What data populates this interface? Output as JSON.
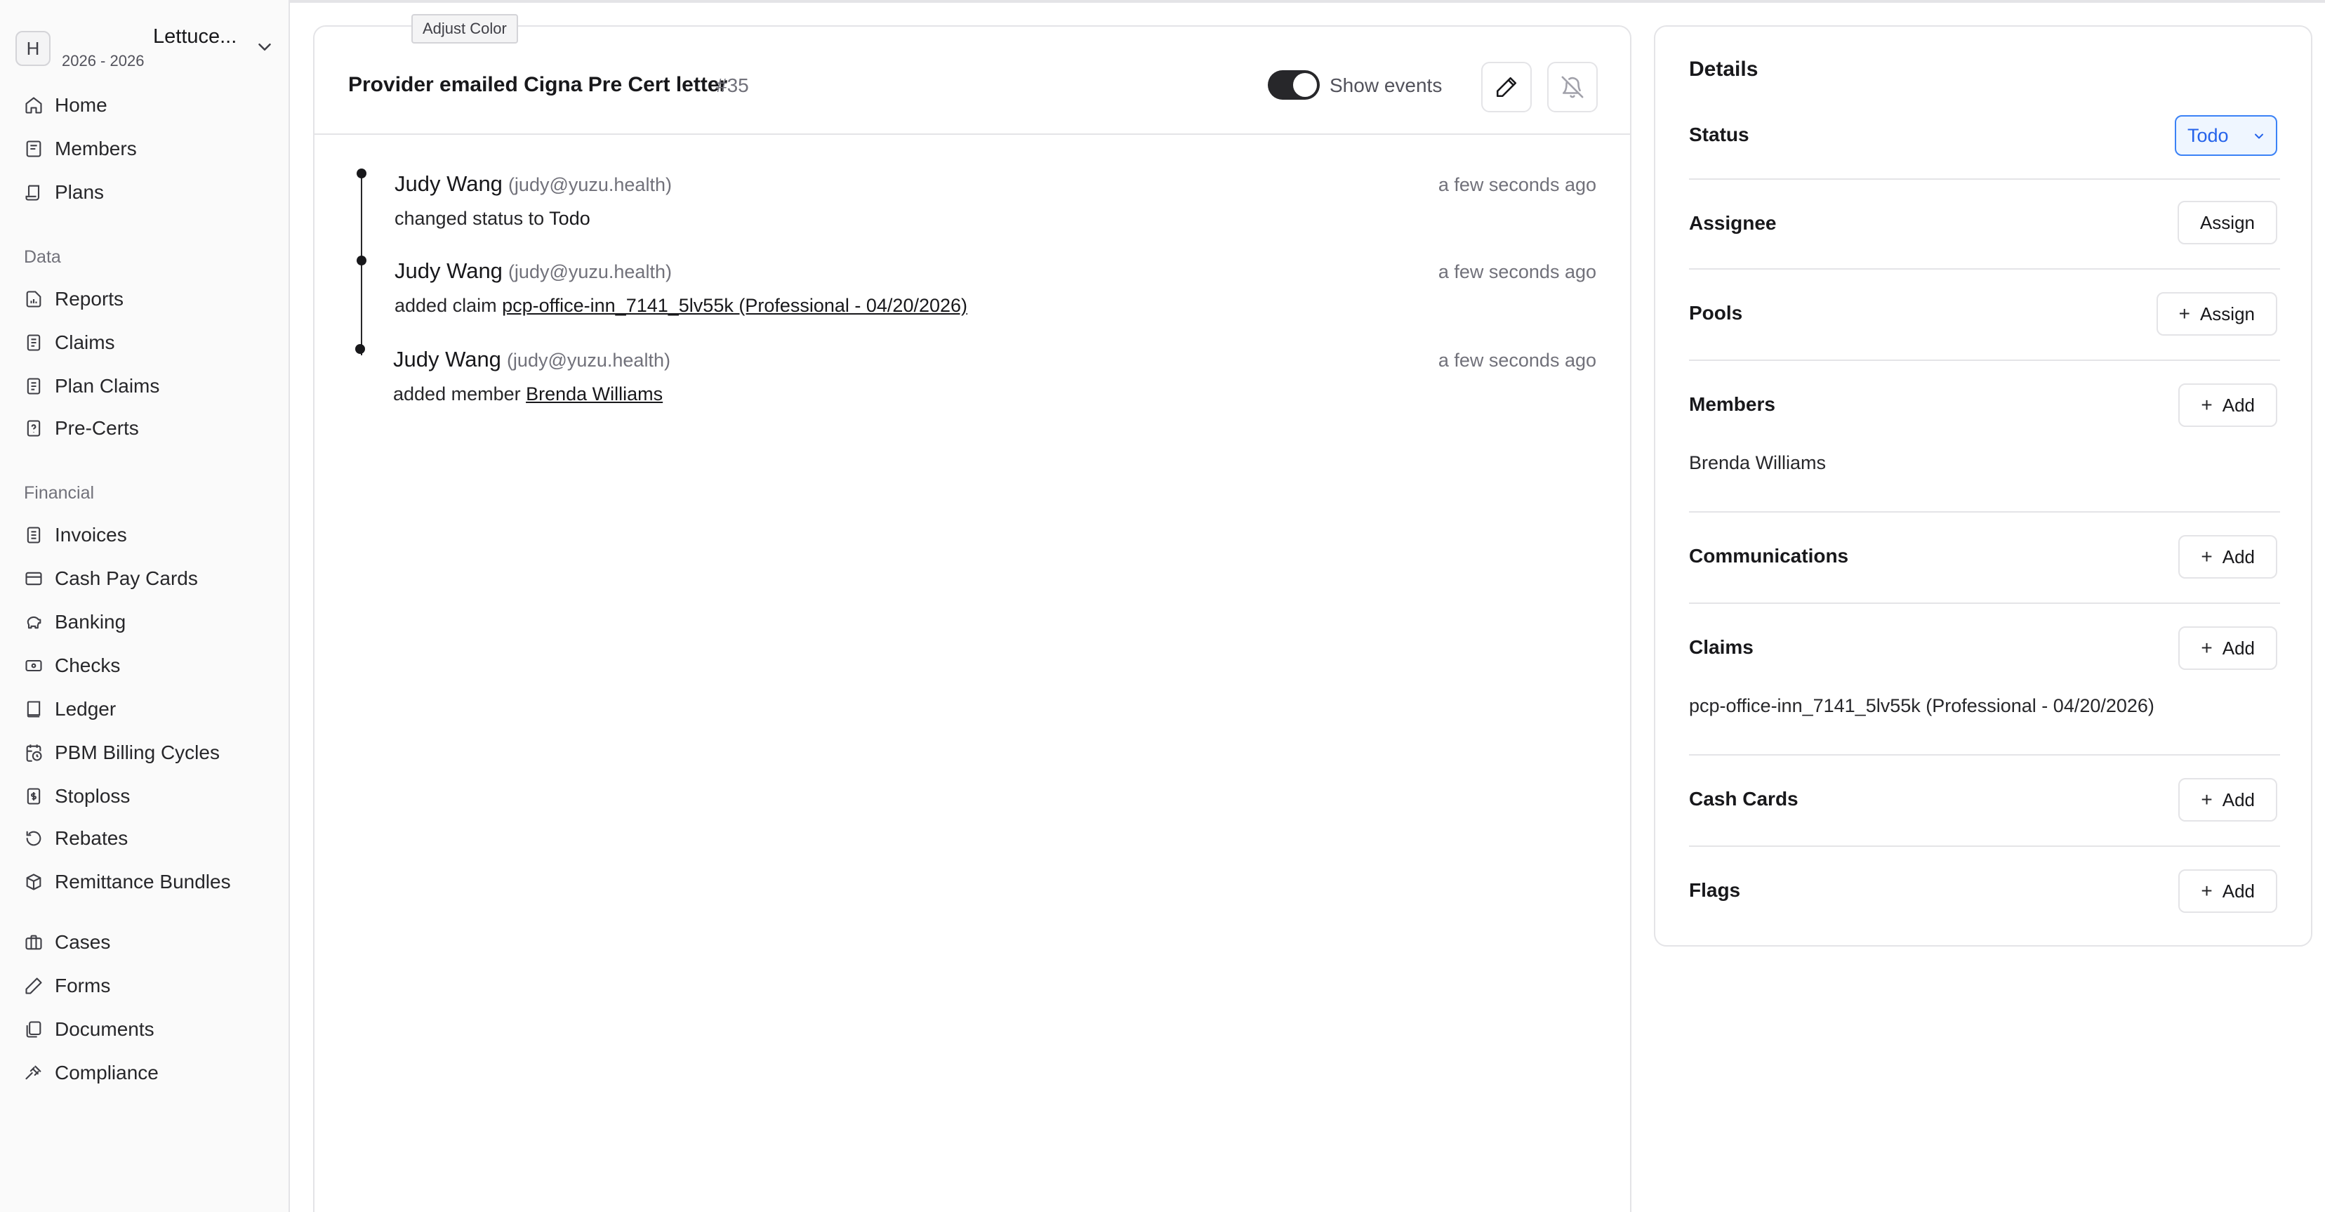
{
  "tooltip": "Adjust Color",
  "org": {
    "avatar_letter": "H",
    "name": "Lettuce...",
    "years": "2026 - 2026",
    "chevron_icon": "chevron-down-icon"
  },
  "sidebar": {
    "top_items": [
      {
        "label": "Home",
        "icon": "home-icon"
      },
      {
        "label": "Members",
        "icon": "book-icon"
      },
      {
        "label": "Plans",
        "icon": "scroll-icon"
      }
    ],
    "data_label": "Data",
    "data_items": [
      {
        "label": "Reports",
        "icon": "file-chart-icon"
      },
      {
        "label": "Claims",
        "icon": "file-text-icon"
      },
      {
        "label": "Plan Claims",
        "icon": "file-text-icon"
      },
      {
        "label": "Pre-Certs",
        "icon": "file-question-icon"
      }
    ],
    "financial_label": "Financial",
    "financial_items": [
      {
        "label": "Invoices",
        "icon": "receipt-icon"
      },
      {
        "label": "Cash Pay Cards",
        "icon": "credit-card-icon"
      },
      {
        "label": "Banking",
        "icon": "piggy-bank-icon"
      },
      {
        "label": "Checks",
        "icon": "banknote-icon"
      },
      {
        "label": "Ledger",
        "icon": "notebook-icon"
      },
      {
        "label": "PBM Billing Cycles",
        "icon": "calendar-clock-icon"
      },
      {
        "label": "Stoploss",
        "icon": "file-dollar-icon"
      },
      {
        "label": "Rebates",
        "icon": "rotate-icon"
      },
      {
        "label": "Remittance Bundles",
        "icon": "package-icon"
      }
    ],
    "other_items": [
      {
        "label": "Cases",
        "icon": "briefcase-icon"
      },
      {
        "label": "Forms",
        "icon": "pen-icon"
      },
      {
        "label": "Documents",
        "icon": "files-icon"
      },
      {
        "label": "Compliance",
        "icon": "gavel-icon"
      }
    ]
  },
  "case": {
    "title": "Provider emailed Cigna Pre Cert letter",
    "number": "#35",
    "show_events_label": "Show events",
    "show_events_on": true
  },
  "events": [
    {
      "author": "Judy Wang",
      "email": "(judy@yuzu.health)",
      "time": "a few seconds ago",
      "prefix": "changed status to ",
      "target": "Todo",
      "target_is_link": false
    },
    {
      "author": "Judy Wang",
      "email": "(judy@yuzu.health)",
      "time": "a few seconds ago",
      "prefix": "added claim ",
      "target": "pcp-office-inn_7141_5lv55k (Professional - 04/20/2026)",
      "target_is_link": true
    },
    {
      "author": "Judy Wang",
      "email": "(judy@yuzu.health)",
      "time": "a few seconds ago",
      "prefix": "added member ",
      "target": "Brenda Williams",
      "target_is_link": true
    }
  ],
  "details": {
    "title": "Details",
    "status_label": "Status",
    "status_value": "Todo",
    "assignee_label": "Assignee",
    "assignee_button": "Assign",
    "pools_label": "Pools",
    "pools_button": "Assign",
    "members_label": "Members",
    "members_button": "Add",
    "members_value": "Brenda Williams",
    "communications_label": "Communications",
    "communications_button": "Add",
    "claims_label": "Claims",
    "claims_button": "Add",
    "claims_value": "pcp-office-inn_7141_5lv55k (Professional - 04/20/2026)",
    "cash_cards_label": "Cash Cards",
    "cash_cards_button": "Add",
    "flags_label": "Flags",
    "flags_button": "Add",
    "accent_color": "#2563eb"
  }
}
